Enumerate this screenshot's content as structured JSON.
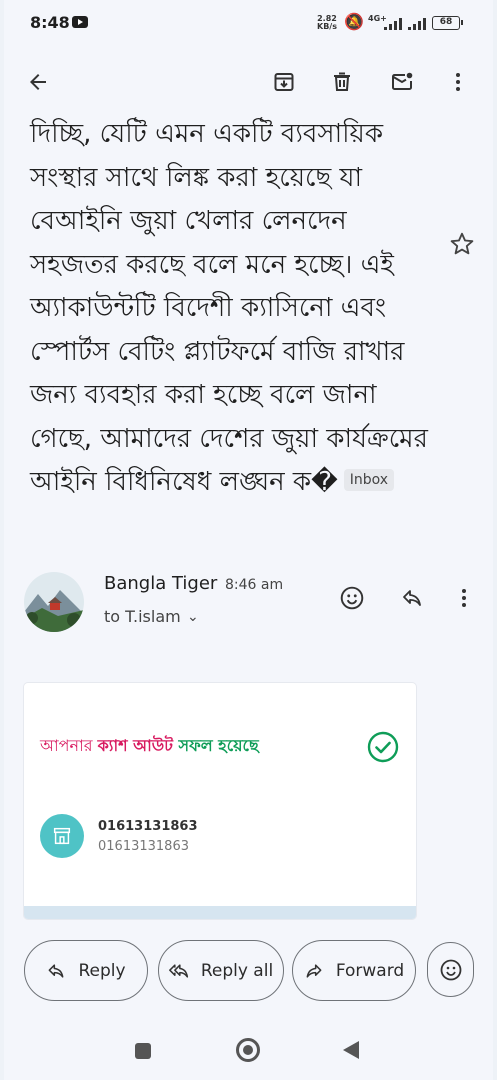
{
  "status_bar": {
    "time": "8:48",
    "speed_value": "2.82",
    "speed_unit": "KB/s",
    "network": "4G+",
    "battery": "68"
  },
  "toolbar": {
    "icons": [
      "back-arrow-icon",
      "archive-icon",
      "delete-icon",
      "mark-unread-icon",
      "more-vert-icon"
    ]
  },
  "message": {
    "body": "দিচ্ছি, যেটি এমন একটি ব্যবসায়িক সংস্থার সাথে লিঙ্ক করা হয়েছে যা বেআইনি জুয়া খেলার লেনদেন সহজতর করছে বলে মনে হচ্ছে। এই অ্যাকাউন্টটি বিদেশী ক্যাসিনো এবং স্পোর্টস বেটিং প্ল্যাটফর্মে বাজি রাখার জন্য ব্যবহার করা হচ্ছে বলে জানা গেছে, আমাদের দেশের জুয়া কার্যক্রমের আইনি বিধিনিষেধ লঙ্ঘন ক�",
    "label": "Inbox"
  },
  "sender": {
    "name": "Bangla Tiger",
    "time": "8:46 am",
    "recipient": "to T.islam"
  },
  "card": {
    "line_part1": "আপনার ",
    "line_part2": "ক্যাশ আউট",
    "line_part3": " সফল হয়েছে",
    "account_primary": "01613131863",
    "account_secondary": "01613131863"
  },
  "actions": {
    "reply": "Reply",
    "reply_all": "Reply all",
    "forward": "Forward"
  },
  "colors": {
    "accent_pink": "#d81b60",
    "accent_green": "#0f9d58",
    "account_icon": "#4fc3c6"
  }
}
